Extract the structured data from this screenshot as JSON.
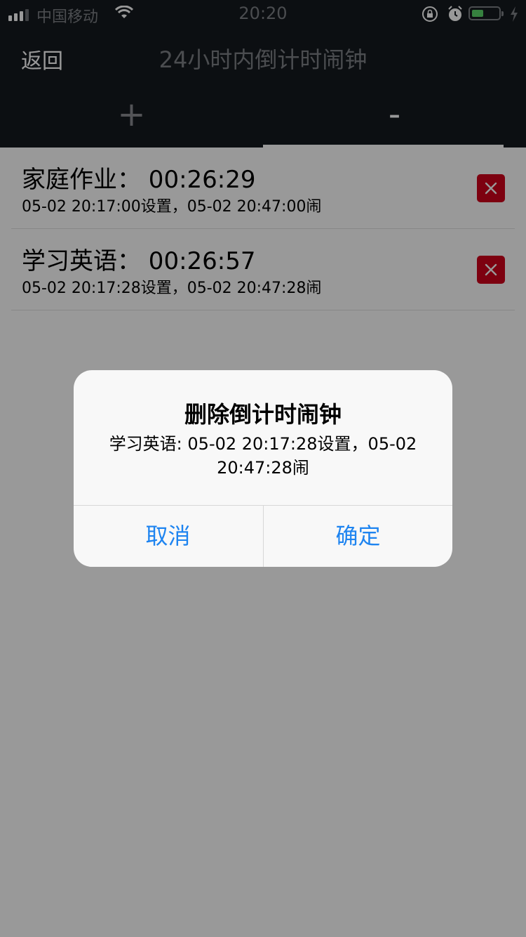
{
  "status_bar": {
    "carrier": "中国移动",
    "time": "20:20",
    "battery_level": 0.45
  },
  "nav": {
    "back_label": "返回",
    "title": "24小时内倒计时闹钟"
  },
  "tabs": {
    "add_label": "+",
    "remove_label": "-",
    "active": "remove"
  },
  "alarms": [
    {
      "title": "家庭作业：  00:26:29",
      "subtitle": "05-02 20:17:00设置，05-02 20:47:00闹"
    },
    {
      "title": "学习英语：  00:26:57",
      "subtitle": "05-02 20:17:28设置，05-02 20:47:28闹"
    }
  ],
  "dialog": {
    "title": "删除倒计时闹钟",
    "message": "学习英语: 05-02 20:17:28设置，05-02 20:47:28闹",
    "cancel_label": "取消",
    "confirm_label": "确定"
  },
  "colors": {
    "nav_background": "#15191e",
    "delete_red": "#d0021b",
    "dialog_button_blue": "#1e84f0",
    "battery_green": "#5bd769"
  },
  "icons": {
    "delete": "close-x-icon",
    "wifi": "wifi-icon",
    "lock": "orientation-lock-icon",
    "alarm": "alarm-clock-icon",
    "charge": "charging-bolt-icon"
  }
}
